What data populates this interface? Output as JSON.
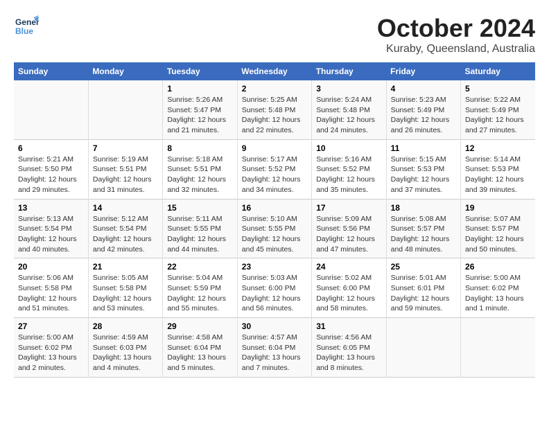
{
  "header": {
    "logo_line1": "General",
    "logo_line2": "Blue",
    "month": "October 2024",
    "location": "Kuraby, Queensland, Australia"
  },
  "weekdays": [
    "Sunday",
    "Monday",
    "Tuesday",
    "Wednesday",
    "Thursday",
    "Friday",
    "Saturday"
  ],
  "weeks": [
    [
      {
        "day": "",
        "info": ""
      },
      {
        "day": "",
        "info": ""
      },
      {
        "day": "1",
        "info": "Sunrise: 5:26 AM\nSunset: 5:47 PM\nDaylight: 12 hours\nand 21 minutes."
      },
      {
        "day": "2",
        "info": "Sunrise: 5:25 AM\nSunset: 5:48 PM\nDaylight: 12 hours\nand 22 minutes."
      },
      {
        "day": "3",
        "info": "Sunrise: 5:24 AM\nSunset: 5:48 PM\nDaylight: 12 hours\nand 24 minutes."
      },
      {
        "day": "4",
        "info": "Sunrise: 5:23 AM\nSunset: 5:49 PM\nDaylight: 12 hours\nand 26 minutes."
      },
      {
        "day": "5",
        "info": "Sunrise: 5:22 AM\nSunset: 5:49 PM\nDaylight: 12 hours\nand 27 minutes."
      }
    ],
    [
      {
        "day": "6",
        "info": "Sunrise: 5:21 AM\nSunset: 5:50 PM\nDaylight: 12 hours\nand 29 minutes."
      },
      {
        "day": "7",
        "info": "Sunrise: 5:19 AM\nSunset: 5:51 PM\nDaylight: 12 hours\nand 31 minutes."
      },
      {
        "day": "8",
        "info": "Sunrise: 5:18 AM\nSunset: 5:51 PM\nDaylight: 12 hours\nand 32 minutes."
      },
      {
        "day": "9",
        "info": "Sunrise: 5:17 AM\nSunset: 5:52 PM\nDaylight: 12 hours\nand 34 minutes."
      },
      {
        "day": "10",
        "info": "Sunrise: 5:16 AM\nSunset: 5:52 PM\nDaylight: 12 hours\nand 35 minutes."
      },
      {
        "day": "11",
        "info": "Sunrise: 5:15 AM\nSunset: 5:53 PM\nDaylight: 12 hours\nand 37 minutes."
      },
      {
        "day": "12",
        "info": "Sunrise: 5:14 AM\nSunset: 5:53 PM\nDaylight: 12 hours\nand 39 minutes."
      }
    ],
    [
      {
        "day": "13",
        "info": "Sunrise: 5:13 AM\nSunset: 5:54 PM\nDaylight: 12 hours\nand 40 minutes."
      },
      {
        "day": "14",
        "info": "Sunrise: 5:12 AM\nSunset: 5:54 PM\nDaylight: 12 hours\nand 42 minutes."
      },
      {
        "day": "15",
        "info": "Sunrise: 5:11 AM\nSunset: 5:55 PM\nDaylight: 12 hours\nand 44 minutes."
      },
      {
        "day": "16",
        "info": "Sunrise: 5:10 AM\nSunset: 5:55 PM\nDaylight: 12 hours\nand 45 minutes."
      },
      {
        "day": "17",
        "info": "Sunrise: 5:09 AM\nSunset: 5:56 PM\nDaylight: 12 hours\nand 47 minutes."
      },
      {
        "day": "18",
        "info": "Sunrise: 5:08 AM\nSunset: 5:57 PM\nDaylight: 12 hours\nand 48 minutes."
      },
      {
        "day": "19",
        "info": "Sunrise: 5:07 AM\nSunset: 5:57 PM\nDaylight: 12 hours\nand 50 minutes."
      }
    ],
    [
      {
        "day": "20",
        "info": "Sunrise: 5:06 AM\nSunset: 5:58 PM\nDaylight: 12 hours\nand 51 minutes."
      },
      {
        "day": "21",
        "info": "Sunrise: 5:05 AM\nSunset: 5:58 PM\nDaylight: 12 hours\nand 53 minutes."
      },
      {
        "day": "22",
        "info": "Sunrise: 5:04 AM\nSunset: 5:59 PM\nDaylight: 12 hours\nand 55 minutes."
      },
      {
        "day": "23",
        "info": "Sunrise: 5:03 AM\nSunset: 6:00 PM\nDaylight: 12 hours\nand 56 minutes."
      },
      {
        "day": "24",
        "info": "Sunrise: 5:02 AM\nSunset: 6:00 PM\nDaylight: 12 hours\nand 58 minutes."
      },
      {
        "day": "25",
        "info": "Sunrise: 5:01 AM\nSunset: 6:01 PM\nDaylight: 12 hours\nand 59 minutes."
      },
      {
        "day": "26",
        "info": "Sunrise: 5:00 AM\nSunset: 6:02 PM\nDaylight: 13 hours\nand 1 minute."
      }
    ],
    [
      {
        "day": "27",
        "info": "Sunrise: 5:00 AM\nSunset: 6:02 PM\nDaylight: 13 hours\nand 2 minutes."
      },
      {
        "day": "28",
        "info": "Sunrise: 4:59 AM\nSunset: 6:03 PM\nDaylight: 13 hours\nand 4 minutes."
      },
      {
        "day": "29",
        "info": "Sunrise: 4:58 AM\nSunset: 6:04 PM\nDaylight: 13 hours\nand 5 minutes."
      },
      {
        "day": "30",
        "info": "Sunrise: 4:57 AM\nSunset: 6:04 PM\nDaylight: 13 hours\nand 7 minutes."
      },
      {
        "day": "31",
        "info": "Sunrise: 4:56 AM\nSunset: 6:05 PM\nDaylight: 13 hours\nand 8 minutes."
      },
      {
        "day": "",
        "info": ""
      },
      {
        "day": "",
        "info": ""
      }
    ]
  ]
}
